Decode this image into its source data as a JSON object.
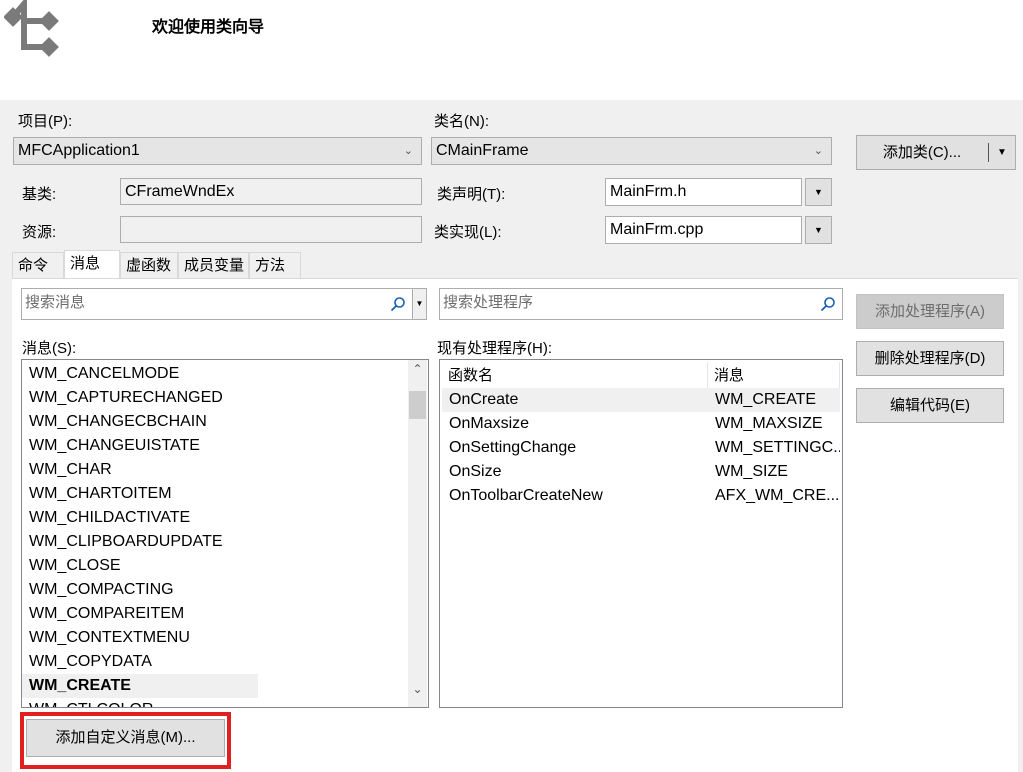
{
  "header": {
    "title": "欢迎使用类向导"
  },
  "project": {
    "label": "项目(P):",
    "value": "MFCApplication1"
  },
  "classname": {
    "label": "类名(N):",
    "value": "CMainFrame"
  },
  "add_class_button": "添加类(C)...",
  "base_class": {
    "label": "基类:",
    "value": "CFrameWndEx"
  },
  "resource": {
    "label": "资源:",
    "value": ""
  },
  "class_decl": {
    "label": "类声明(T):",
    "value": "MainFrm.h"
  },
  "class_impl": {
    "label": "类实现(L):",
    "value": "MainFrm.cpp"
  },
  "tabs": [
    {
      "label": "命令"
    },
    {
      "label": "消息"
    },
    {
      "label": "虚函数"
    },
    {
      "label": "成员变量"
    },
    {
      "label": "方法"
    }
  ],
  "search_messages": {
    "placeholder": "搜索消息"
  },
  "search_handlers": {
    "placeholder": "搜索处理程序"
  },
  "messages_label": "消息(S):",
  "messages": [
    "WM_CANCELMODE",
    "WM_CAPTURECHANGED",
    "WM_CHANGECBCHAIN",
    "WM_CHANGEUISTATE",
    "WM_CHAR",
    "WM_CHARTOITEM",
    "WM_CHILDACTIVATE",
    "WM_CLIPBOARDUPDATE",
    "WM_CLOSE",
    "WM_COMPACTING",
    "WM_COMPAREITEM",
    "WM_CONTEXTMENU",
    "WM_COPYDATA",
    "WM_CREATE",
    "WM_CTLCOLOR"
  ],
  "selected_message": "WM_CREATE",
  "handlers_label": "现有处理程序(H):",
  "handlers_table": {
    "columns": [
      "函数名",
      "消息"
    ],
    "rows": [
      [
        "OnCreate",
        "WM_CREATE"
      ],
      [
        "OnMaxsize",
        "WM_MAXSIZE"
      ],
      [
        "OnSettingChange",
        "WM_SETTINGC..."
      ],
      [
        "OnSize",
        "WM_SIZE"
      ],
      [
        "OnToolbarCreateNew",
        "AFX_WM_CRE..."
      ]
    ]
  },
  "buttons": {
    "add_handler": "添加处理程序(A)",
    "delete_handler": "删除处理程序(D)",
    "edit_code": "编辑代码(E)",
    "add_custom_message": "添加自定义消息(M)..."
  },
  "colors": {
    "highlight_box": "#e02020"
  }
}
